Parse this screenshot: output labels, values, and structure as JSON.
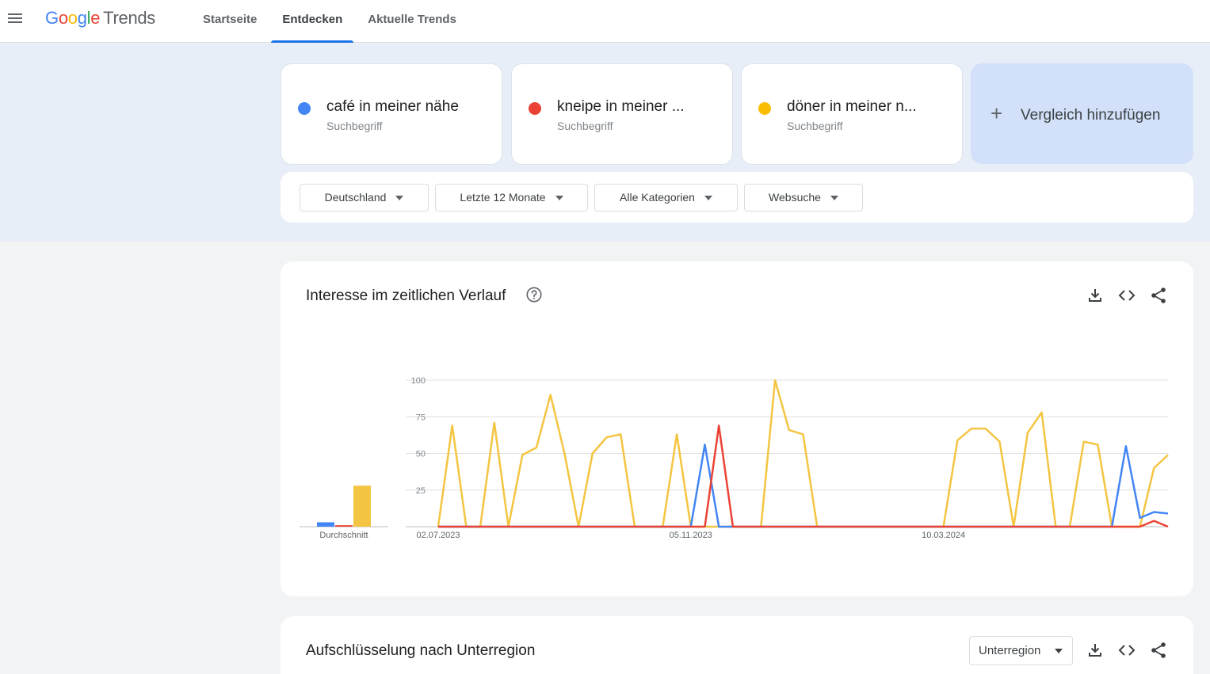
{
  "header": {
    "logo_google": [
      "G",
      "o",
      "o",
      "g",
      "l",
      "e"
    ],
    "logo_product": "Trends",
    "tabs": [
      {
        "label": "Startseite",
        "active": false
      },
      {
        "label": "Entdecken",
        "active": true
      },
      {
        "label": "Aktuelle Trends",
        "active": false
      }
    ]
  },
  "terms": [
    {
      "term": "café in meiner nähe",
      "type": "Suchbegriff",
      "color": "#4285f4"
    },
    {
      "term": "kneipe in meiner ...",
      "type": "Suchbegriff",
      "color": "#ea4335"
    },
    {
      "term": "döner in meiner n...",
      "type": "Suchbegriff",
      "color": "#fbbc04"
    }
  ],
  "compare": {
    "label": "Vergleich hinzufügen"
  },
  "filters": {
    "region": "Deutschland",
    "time": "Letzte 12 Monate",
    "category": "Alle Kategorien",
    "search_type": "Websuche"
  },
  "interest_panel": {
    "title": "Interesse im zeitlichen Verlauf"
  },
  "subregion_panel": {
    "title": "Aufschlüsselung nach Unterregion",
    "select_value": "Unterregion"
  },
  "icons": {
    "menu": "menu-icon",
    "help": "help-icon",
    "download": "download-icon",
    "embed": "embed-icon",
    "share": "share-icon",
    "add": "plus-icon"
  },
  "chart_data": {
    "type": "line",
    "ylim": [
      0,
      100
    ],
    "yticks": [
      25,
      50,
      75,
      100
    ],
    "x_tick_labels": [
      "02.07.2023",
      "05.11.2023",
      "10.03.2024"
    ],
    "x_tick_index": [
      0,
      18,
      36
    ],
    "average": {
      "label": "Durchschnitt",
      "values": [
        3,
        1,
        28
      ]
    },
    "series": [
      {
        "term": "café in meiner nähe",
        "color": "#4285f4",
        "values": [
          0,
          0,
          0,
          0,
          0,
          0,
          0,
          0,
          0,
          0,
          0,
          0,
          0,
          0,
          0,
          0,
          0,
          0,
          0,
          56,
          0,
          0,
          0,
          0,
          0,
          0,
          0,
          0,
          0,
          0,
          0,
          0,
          0,
          0,
          0,
          0,
          0,
          0,
          0,
          0,
          0,
          0,
          0,
          0,
          0,
          0,
          0,
          0,
          0,
          55,
          6,
          10,
          9
        ]
      },
      {
        "term": "kneipe in meiner ...",
        "color": "#ea4335",
        "values": [
          0,
          0,
          0,
          0,
          0,
          0,
          0,
          0,
          0,
          0,
          0,
          0,
          0,
          0,
          0,
          0,
          0,
          0,
          0,
          0,
          69,
          0,
          0,
          0,
          0,
          0,
          0,
          0,
          0,
          0,
          0,
          0,
          0,
          0,
          0,
          0,
          0,
          0,
          0,
          0,
          0,
          0,
          0,
          0,
          0,
          0,
          0,
          0,
          0,
          0,
          0,
          4,
          0
        ]
      },
      {
        "term": "döner in meiner n...",
        "color": "#f4c542",
        "values": [
          0,
          69,
          0,
          0,
          71,
          0,
          49,
          54,
          90,
          50,
          0,
          50,
          61,
          63,
          0,
          0,
          0,
          63,
          0,
          0,
          0,
          0,
          0,
          0,
          100,
          66,
          63,
          0,
          0,
          0,
          0,
          0,
          0,
          0,
          0,
          0,
          0,
          59,
          67,
          67,
          58,
          0,
          64,
          78,
          0,
          0,
          58,
          56,
          0,
          0,
          0,
          40,
          49
        ]
      }
    ]
  }
}
